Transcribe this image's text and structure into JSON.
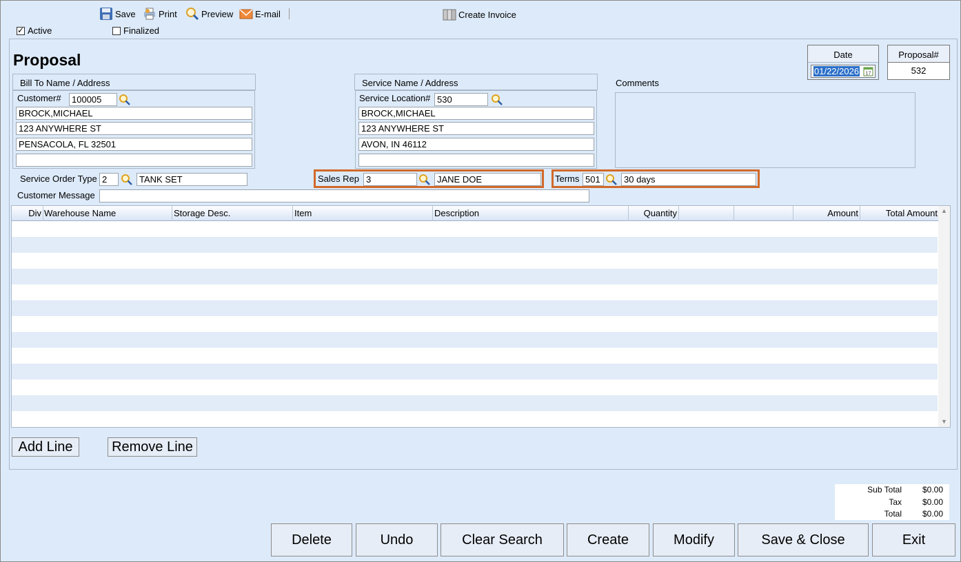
{
  "toolbar": {
    "save_label": "Save",
    "print_label": "Print",
    "preview_label": "Preview",
    "email_label": "E-mail",
    "create_invoice_label": "Create Invoice"
  },
  "flags": {
    "active_label": "Active",
    "active_checked": true,
    "finalized_label": "Finalized",
    "finalized_checked": false
  },
  "page_title": "Proposal",
  "date": {
    "label": "Date",
    "value": "01/22/2026"
  },
  "proposal_no": {
    "label": "Proposal#",
    "value": "532"
  },
  "bill_to": {
    "header": "Bill To Name / Address",
    "customer_label": "Customer#",
    "customer_no": "100005",
    "name": "BROCK,MICHAEL",
    "address1": "123 ANYWHERE ST",
    "address2": "PENSACOLA, FL  32501",
    "address3": ""
  },
  "service": {
    "header": "Service Name / Address",
    "location_label": "Service Location#",
    "location_no": "530",
    "name": "BROCK,MICHAEL",
    "address1": "123 ANYWHERE ST",
    "address2": "AVON, IN  46112",
    "address3": ""
  },
  "comments": {
    "label": "Comments",
    "value": ""
  },
  "service_order_type": {
    "label": "Service Order Type",
    "code": "2",
    "name": "TANK SET"
  },
  "sales_rep": {
    "label": "Sales Rep",
    "code": "3",
    "name": "JANE DOE"
  },
  "terms": {
    "label": "Terms",
    "code": "501",
    "name": "30 days"
  },
  "customer_message": {
    "label": "Customer Message",
    "value": ""
  },
  "grid": {
    "columns": [
      "Div",
      "Warehouse Name",
      "Storage Desc.",
      "Item",
      "Description",
      "Quantity",
      "",
      "",
      "Amount",
      "Total Amount"
    ]
  },
  "line_buttons": {
    "add": "Add Line",
    "remove": "Remove Line"
  },
  "totals": {
    "subtotal_label": "Sub Total",
    "subtotal": "$0.00",
    "tax_label": "Tax",
    "tax": "$0.00",
    "total_label": "Total",
    "total": "$0.00"
  },
  "actions": {
    "delete": "Delete",
    "undo": "Undo",
    "clear_search": "Clear Search",
    "create": "Create",
    "modify": "Modify",
    "save_close": "Save & Close",
    "exit": "Exit"
  },
  "colors": {
    "highlight": "#d1692a",
    "background": "#ddeaf9",
    "grid_alt_row": "#e2ecf8"
  }
}
